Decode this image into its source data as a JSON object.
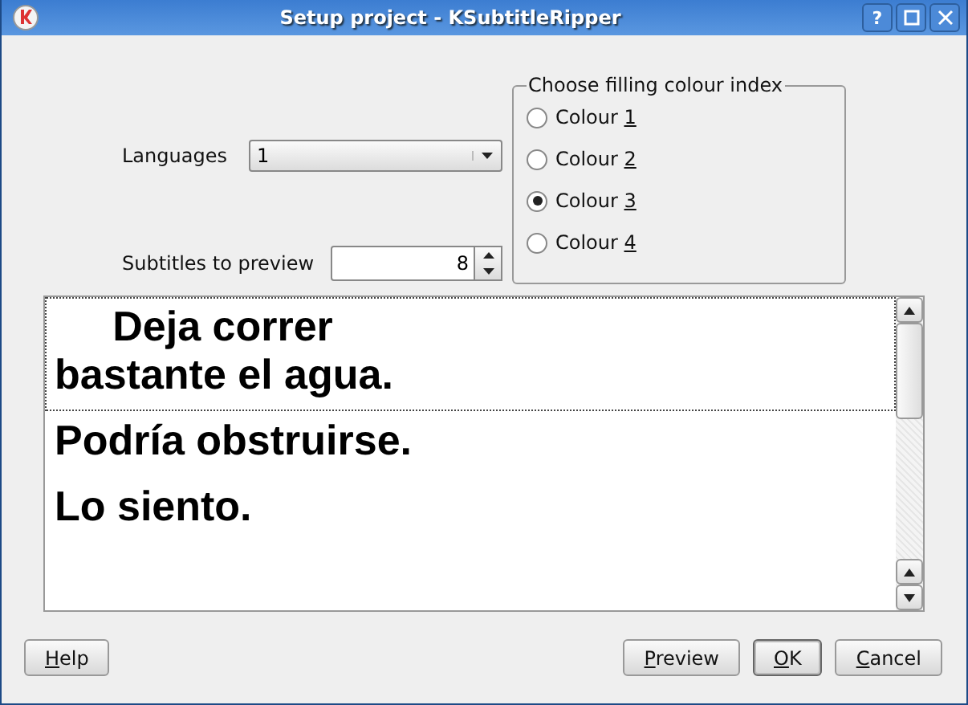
{
  "window": {
    "title": "Setup project - KSubtitleRipper",
    "controls": [
      {
        "kind": "help",
        "label": "?"
      },
      {
        "kind": "maximize"
      },
      {
        "kind": "close"
      }
    ]
  },
  "languages": {
    "label": "Languages",
    "value": "1"
  },
  "subtitles_to_preview": {
    "label": "Subtitles to preview",
    "value": "8"
  },
  "colour_group": {
    "title": "Choose filling colour index",
    "options": [
      {
        "text": "Colour ",
        "accel": "1",
        "selected": false
      },
      {
        "text": "Colour ",
        "accel": "2",
        "selected": false
      },
      {
        "text": "Colour ",
        "accel": "3",
        "selected": true
      },
      {
        "text": "Colour ",
        "accel": "4",
        "selected": false
      }
    ]
  },
  "preview": {
    "items": [
      {
        "lines": [
          "     Deja correr",
          "bastante el agua."
        ],
        "focused": true
      },
      {
        "lines": [
          "Podría obstruirse."
        ],
        "focused": false
      },
      {
        "lines": [
          "Lo siento."
        ],
        "focused": false
      }
    ]
  },
  "buttons": [
    {
      "kind": "left",
      "accel": "H",
      "after": "elp",
      "default": false
    },
    {
      "kind": "right",
      "accel": "P",
      "after": "review",
      "default": false
    },
    {
      "kind": "right",
      "accel": "O",
      "after": "K",
      "default": true
    },
    {
      "kind": "right",
      "accel": "C",
      "after": "ancel",
      "default": false
    }
  ]
}
